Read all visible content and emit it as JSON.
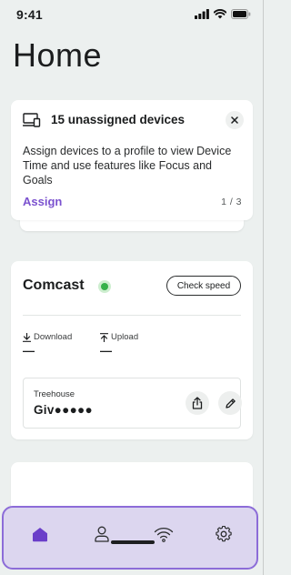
{
  "status_bar": {
    "time": "9:41",
    "icons": [
      "signal-icon",
      "wifi-icon",
      "battery-icon"
    ]
  },
  "page": {
    "title": "Home"
  },
  "notice_card": {
    "icon": "devices-icon",
    "title": "15 unassigned devices",
    "close_icon": "close-icon",
    "body": "Assign devices to a profile to view Device Time and use features like Focus and Goals",
    "action_label": "Assign",
    "pager": "1 / 3"
  },
  "network_card": {
    "isp_name": "Comcast",
    "status": "online",
    "status_color": "#35b14a",
    "check_speed_label": "Check speed",
    "download": {
      "label": "Download",
      "value": "—"
    },
    "upload": {
      "label": "Upload",
      "value": "—"
    },
    "network": {
      "label": "Treehouse",
      "password": "Giv●●●●●",
      "share_icon": "share-icon",
      "edit_icon": "pencil-icon"
    }
  },
  "bottom_nav": {
    "items": [
      {
        "name": "home",
        "icon": "home-icon",
        "active": true
      },
      {
        "name": "profiles",
        "icon": "person-icon",
        "active": false
      },
      {
        "name": "wifi",
        "icon": "wifi-icon",
        "active": false
      },
      {
        "name": "settings",
        "icon": "gear-icon",
        "active": false
      }
    ],
    "highlight_color": "#8c6cd8",
    "active_color": "#6a3fc9"
  }
}
